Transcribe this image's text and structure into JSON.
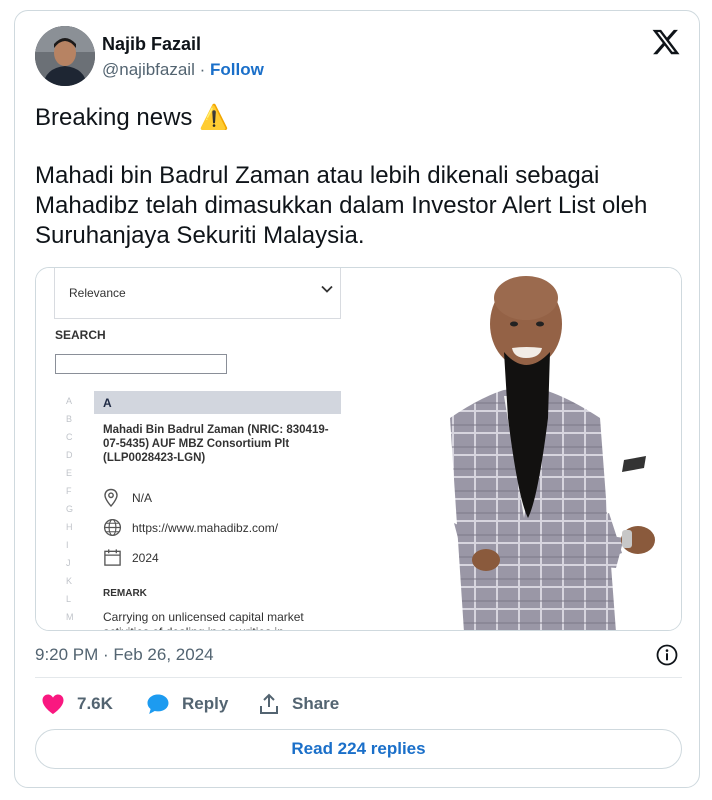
{
  "author": {
    "name": "Najib Fazail",
    "handle": "@najibfazail",
    "separator": " · ",
    "follow_label": "Follow"
  },
  "tweet": {
    "text_line1": "Breaking news ",
    "warning_emoji": "⚠️",
    "body": "Mahadi bin Badrul Zaman atau lebih dikenali sebagai Mahadibz telah dimasukkan dalam Investor Alert List oleh Suruhanjaya Sekuriti Malaysia."
  },
  "media": {
    "sort_select": "Relevance",
    "search_label": "SEARCH",
    "search_value": "",
    "alphabet": [
      "A",
      "B",
      "C",
      "D",
      "E",
      "F",
      "G",
      "H",
      "I",
      "J",
      "K",
      "L",
      "M"
    ],
    "section_letter": "A",
    "entry_title": "Mahadi Bin Badrul Zaman (NRIC: 830419-07-5435) AUF MBZ Consortium Plt (LLP0028423-LGN)",
    "address": "N/A",
    "website": "https://www.mahadibz.com/",
    "year": "2024",
    "remark_heading": "REMARK",
    "remark_text": "Carrying on unlicensed capital market activities of dealing in securities in"
  },
  "footer": {
    "timestamp": "9:20 PM · Feb 26, 2024",
    "likes": "7.6K",
    "reply_label": "Reply",
    "share_label": "Share",
    "read_replies_label": "Read 224 replies"
  },
  "colors": {
    "accent": "#1a6fc9",
    "like_heart": "#f91880",
    "reply_bubble": "#1d9bf0",
    "muted": "#536471",
    "border": "#cfd9de"
  },
  "icons": {
    "brand": "x-logo-icon",
    "info": "info-icon",
    "like": "heart-icon",
    "reply": "speech-bubble-icon",
    "share": "share-upload-icon",
    "location": "location-pin-icon",
    "globe": "globe-icon",
    "calendar": "calendar-icon"
  }
}
